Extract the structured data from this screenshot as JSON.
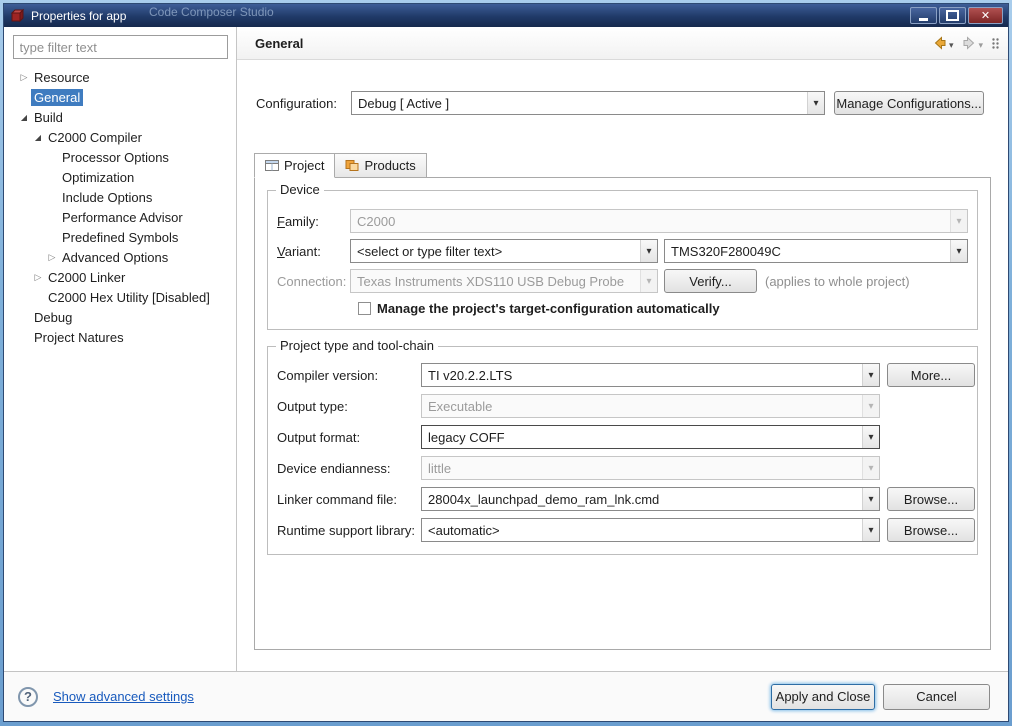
{
  "window": {
    "title": "Properties for app",
    "background_window_title": "Code Composer Studio"
  },
  "sidebar": {
    "filter_placeholder": "type filter text",
    "tree": [
      {
        "label": "Resource",
        "level": 0,
        "twistie": "collapsed",
        "selected": false
      },
      {
        "label": "General",
        "level": 0,
        "twistie": "none",
        "selected": true
      },
      {
        "label": "Build",
        "level": 0,
        "twistie": "expanded",
        "selected": false
      },
      {
        "label": "C2000 Compiler",
        "level": 1,
        "twistie": "expanded",
        "selected": false
      },
      {
        "label": "Processor Options",
        "level": 2,
        "twistie": "none",
        "selected": false
      },
      {
        "label": "Optimization",
        "level": 2,
        "twistie": "none",
        "selected": false
      },
      {
        "label": "Include Options",
        "level": 2,
        "twistie": "none",
        "selected": false
      },
      {
        "label": "Performance Advisor",
        "level": 2,
        "twistie": "none",
        "selected": false
      },
      {
        "label": "Predefined Symbols",
        "level": 2,
        "twistie": "none",
        "selected": false
      },
      {
        "label": "Advanced Options",
        "level": 2,
        "twistie": "collapsed",
        "selected": false
      },
      {
        "label": "C2000 Linker",
        "level": 1,
        "twistie": "collapsed",
        "selected": false
      },
      {
        "label": "C2000 Hex Utility  [Disabled]",
        "level": 1,
        "twistie": "none",
        "selected": false
      },
      {
        "label": "Debug",
        "level": 0,
        "twistie": "none",
        "selected": false
      },
      {
        "label": "Project Natures",
        "level": 0,
        "twistie": "none",
        "selected": false
      }
    ]
  },
  "header": {
    "title": "General"
  },
  "configuration": {
    "label": "Configuration:",
    "value": "Debug  [ Active ]",
    "manage_button_label": "Manage Configurations..."
  },
  "tabs": {
    "project": "Project",
    "products": "Products"
  },
  "device": {
    "group_title": "Device",
    "family_label": "Family:",
    "family_value": "C2000",
    "variant_label": "Variant:",
    "variant_filter_value": "<select or type filter text>",
    "variant_value": "TMS320F280049C",
    "connection_label": "Connection:",
    "connection_value": "Texas Instruments XDS110 USB Debug Probe",
    "verify_button_label": "Verify...",
    "connection_note": "(applies to whole project)",
    "manage_target_checkbox_label": "Manage the project's target-configuration automatically",
    "manage_target_checked": false
  },
  "toolchain": {
    "group_title": "Project type and tool-chain",
    "rows": [
      {
        "label": "Compiler version:",
        "value": "TI v20.2.2.LTS",
        "button": "More..."
      },
      {
        "label": "Output type:",
        "value": "Executable"
      },
      {
        "label": "Output format:",
        "value": "legacy COFF"
      },
      {
        "label": "Device endianness:",
        "value": "little"
      },
      {
        "label": "Linker command file:",
        "value": "28004x_launchpad_demo_ram_lnk.cmd",
        "button": "Browse..."
      },
      {
        "label": "Runtime support library:",
        "value": "<automatic>",
        "button": "Browse..."
      }
    ]
  },
  "footer": {
    "advanced_settings_link": "Show advanced settings",
    "apply_button_label": "Apply and Close",
    "cancel_button_label": "Cancel"
  }
}
